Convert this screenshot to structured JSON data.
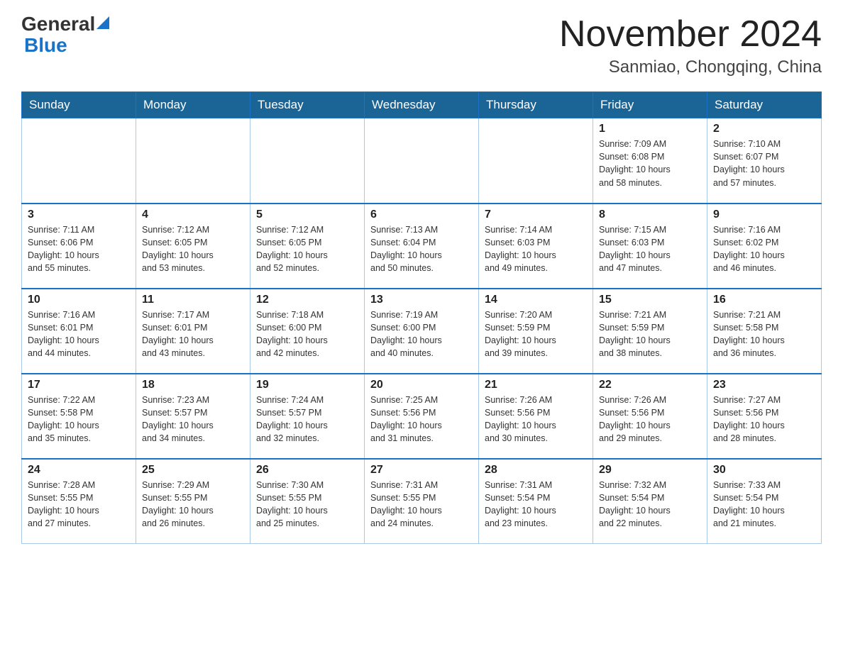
{
  "header": {
    "logo_general": "General",
    "logo_blue": "Blue",
    "month_title": "November 2024",
    "location": "Sanmiao, Chongqing, China"
  },
  "weekdays": [
    "Sunday",
    "Monday",
    "Tuesday",
    "Wednesday",
    "Thursday",
    "Friday",
    "Saturday"
  ],
  "weeks": [
    [
      {
        "day": "",
        "info": ""
      },
      {
        "day": "",
        "info": ""
      },
      {
        "day": "",
        "info": ""
      },
      {
        "day": "",
        "info": ""
      },
      {
        "day": "",
        "info": ""
      },
      {
        "day": "1",
        "info": "Sunrise: 7:09 AM\nSunset: 6:08 PM\nDaylight: 10 hours\nand 58 minutes."
      },
      {
        "day": "2",
        "info": "Sunrise: 7:10 AM\nSunset: 6:07 PM\nDaylight: 10 hours\nand 57 minutes."
      }
    ],
    [
      {
        "day": "3",
        "info": "Sunrise: 7:11 AM\nSunset: 6:06 PM\nDaylight: 10 hours\nand 55 minutes."
      },
      {
        "day": "4",
        "info": "Sunrise: 7:12 AM\nSunset: 6:05 PM\nDaylight: 10 hours\nand 53 minutes."
      },
      {
        "day": "5",
        "info": "Sunrise: 7:12 AM\nSunset: 6:05 PM\nDaylight: 10 hours\nand 52 minutes."
      },
      {
        "day": "6",
        "info": "Sunrise: 7:13 AM\nSunset: 6:04 PM\nDaylight: 10 hours\nand 50 minutes."
      },
      {
        "day": "7",
        "info": "Sunrise: 7:14 AM\nSunset: 6:03 PM\nDaylight: 10 hours\nand 49 minutes."
      },
      {
        "day": "8",
        "info": "Sunrise: 7:15 AM\nSunset: 6:03 PM\nDaylight: 10 hours\nand 47 minutes."
      },
      {
        "day": "9",
        "info": "Sunrise: 7:16 AM\nSunset: 6:02 PM\nDaylight: 10 hours\nand 46 minutes."
      }
    ],
    [
      {
        "day": "10",
        "info": "Sunrise: 7:16 AM\nSunset: 6:01 PM\nDaylight: 10 hours\nand 44 minutes."
      },
      {
        "day": "11",
        "info": "Sunrise: 7:17 AM\nSunset: 6:01 PM\nDaylight: 10 hours\nand 43 minutes."
      },
      {
        "day": "12",
        "info": "Sunrise: 7:18 AM\nSunset: 6:00 PM\nDaylight: 10 hours\nand 42 minutes."
      },
      {
        "day": "13",
        "info": "Sunrise: 7:19 AM\nSunset: 6:00 PM\nDaylight: 10 hours\nand 40 minutes."
      },
      {
        "day": "14",
        "info": "Sunrise: 7:20 AM\nSunset: 5:59 PM\nDaylight: 10 hours\nand 39 minutes."
      },
      {
        "day": "15",
        "info": "Sunrise: 7:21 AM\nSunset: 5:59 PM\nDaylight: 10 hours\nand 38 minutes."
      },
      {
        "day": "16",
        "info": "Sunrise: 7:21 AM\nSunset: 5:58 PM\nDaylight: 10 hours\nand 36 minutes."
      }
    ],
    [
      {
        "day": "17",
        "info": "Sunrise: 7:22 AM\nSunset: 5:58 PM\nDaylight: 10 hours\nand 35 minutes."
      },
      {
        "day": "18",
        "info": "Sunrise: 7:23 AM\nSunset: 5:57 PM\nDaylight: 10 hours\nand 34 minutes."
      },
      {
        "day": "19",
        "info": "Sunrise: 7:24 AM\nSunset: 5:57 PM\nDaylight: 10 hours\nand 32 minutes."
      },
      {
        "day": "20",
        "info": "Sunrise: 7:25 AM\nSunset: 5:56 PM\nDaylight: 10 hours\nand 31 minutes."
      },
      {
        "day": "21",
        "info": "Sunrise: 7:26 AM\nSunset: 5:56 PM\nDaylight: 10 hours\nand 30 minutes."
      },
      {
        "day": "22",
        "info": "Sunrise: 7:26 AM\nSunset: 5:56 PM\nDaylight: 10 hours\nand 29 minutes."
      },
      {
        "day": "23",
        "info": "Sunrise: 7:27 AM\nSunset: 5:56 PM\nDaylight: 10 hours\nand 28 minutes."
      }
    ],
    [
      {
        "day": "24",
        "info": "Sunrise: 7:28 AM\nSunset: 5:55 PM\nDaylight: 10 hours\nand 27 minutes."
      },
      {
        "day": "25",
        "info": "Sunrise: 7:29 AM\nSunset: 5:55 PM\nDaylight: 10 hours\nand 26 minutes."
      },
      {
        "day": "26",
        "info": "Sunrise: 7:30 AM\nSunset: 5:55 PM\nDaylight: 10 hours\nand 25 minutes."
      },
      {
        "day": "27",
        "info": "Sunrise: 7:31 AM\nSunset: 5:55 PM\nDaylight: 10 hours\nand 24 minutes."
      },
      {
        "day": "28",
        "info": "Sunrise: 7:31 AM\nSunset: 5:54 PM\nDaylight: 10 hours\nand 23 minutes."
      },
      {
        "day": "29",
        "info": "Sunrise: 7:32 AM\nSunset: 5:54 PM\nDaylight: 10 hours\nand 22 minutes."
      },
      {
        "day": "30",
        "info": "Sunrise: 7:33 AM\nSunset: 5:54 PM\nDaylight: 10 hours\nand 21 minutes."
      }
    ]
  ]
}
